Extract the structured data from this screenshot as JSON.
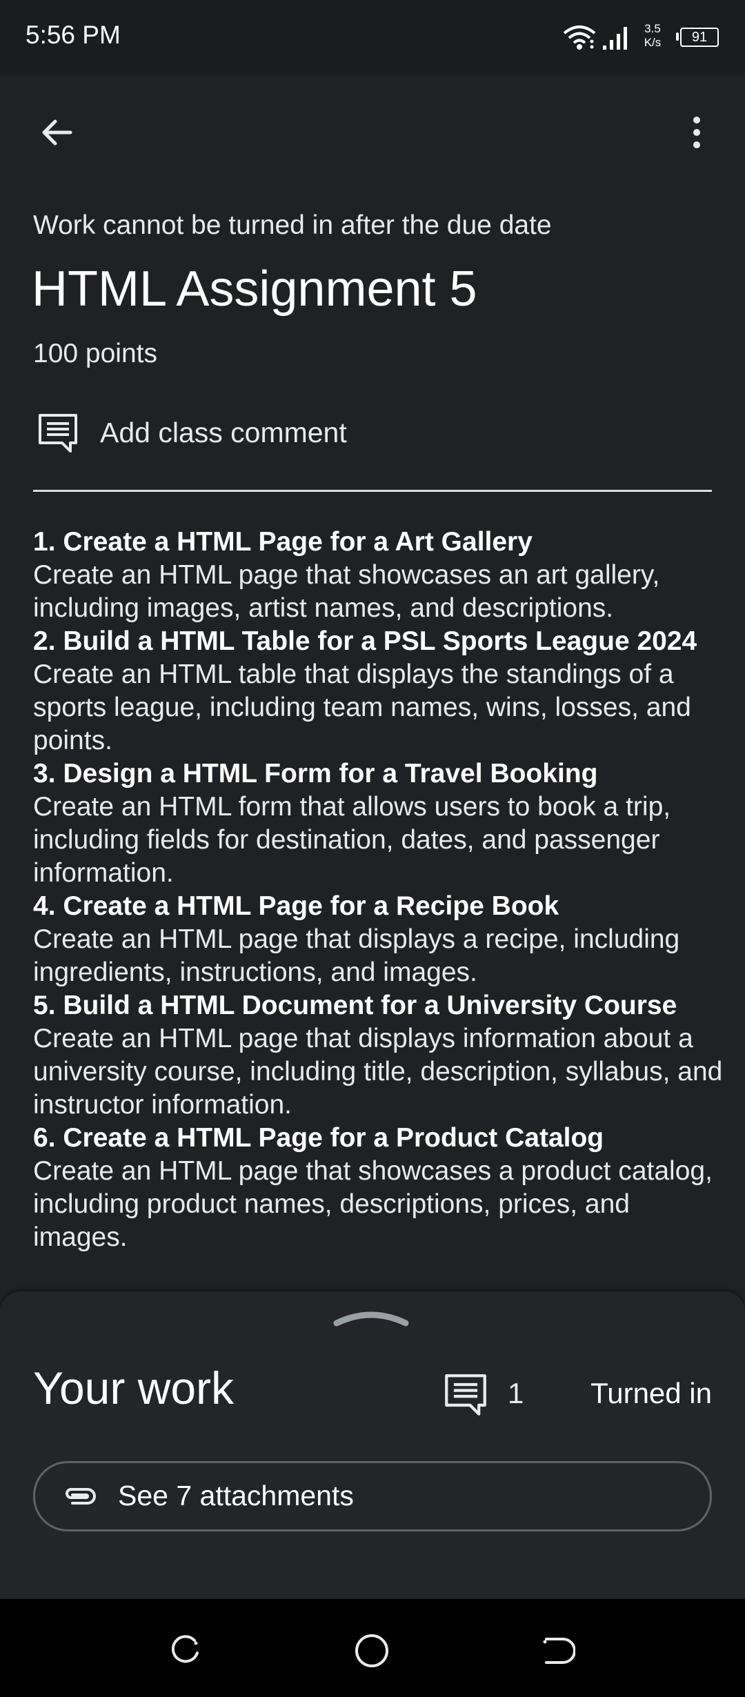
{
  "status_bar": {
    "time": "5:56 PM",
    "net_speed_value": "3.5",
    "net_speed_unit": "K/s",
    "battery": "91"
  },
  "assignment": {
    "note": "Work cannot be turned in after the due date",
    "title": "HTML Assignment 5",
    "points": "100 points",
    "add_comment_label": "Add class comment"
  },
  "tasks": [
    {
      "title": "1. Create a HTML Page for a Art Gallery",
      "description": "Create an HTML page that showcases an art gallery, including images, artist names, and descriptions."
    },
    {
      "title": "2. Build a HTML Table for a PSL Sports League 2024",
      "description": "Create an HTML table that displays the standings of a sports league, including team names, wins, losses, and points."
    },
    {
      "title": "3. Design a HTML Form for a Travel Booking",
      "description": "Create an HTML form that allows users to book a trip, including fields for destination, dates, and passenger information."
    },
    {
      "title": "4. Create a HTML Page for a Recipe Book",
      "description": "Create an HTML page that displays a recipe, including ingredients, instructions, and images."
    },
    {
      "title": "5. Build a HTML Document for a University Course",
      "description": "Create an HTML page that displays information about a university course, including title, description, syllabus, and instructor information."
    },
    {
      "title": "6. Create a HTML Page for a Product Catalog",
      "description": "Create an HTML page that showcases a product catalog, including product names, descriptions, prices, and images."
    }
  ],
  "your_work": {
    "heading": "Your work",
    "comment_count": "1",
    "status": "Turned in",
    "attachments_label": "See 7 attachments"
  },
  "icons": {
    "back": "arrow-back-icon",
    "more": "more-vert-icon",
    "comment": "comment-icon",
    "paperclip": "paperclip-icon",
    "handle": "chevron-up-icon"
  },
  "colors": {
    "background": "#202124",
    "sheet": "#242528",
    "text": "#e8eaed",
    "divider": "#dadce0"
  }
}
